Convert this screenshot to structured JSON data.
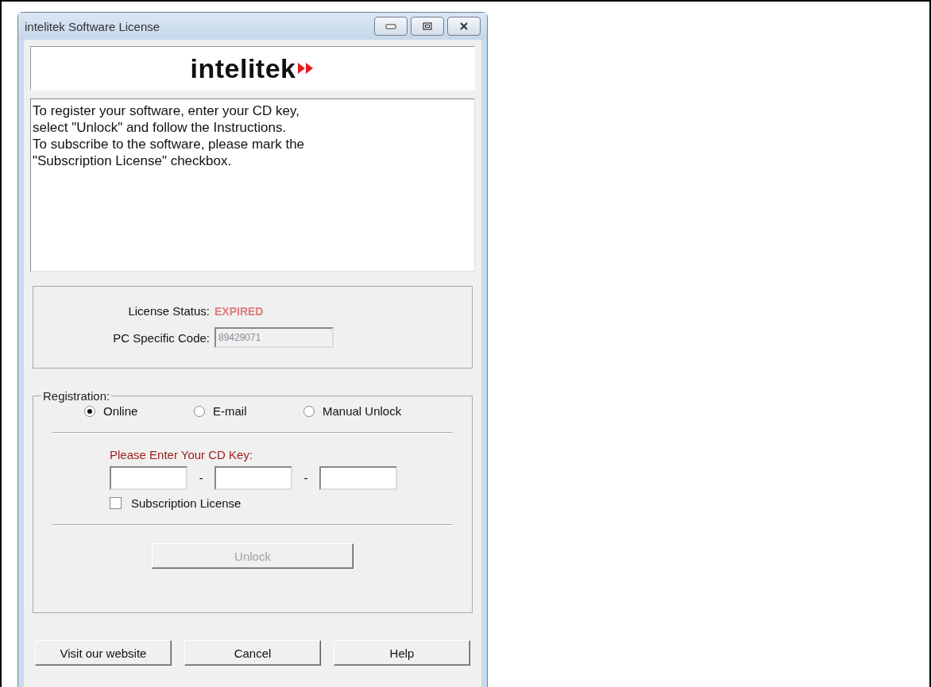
{
  "window": {
    "title": "intelitek Software License"
  },
  "logo": {
    "text": "intelitek"
  },
  "instructions": [
    "To register your software, enter your CD key,",
    "select \"Unlock\" and follow the Instructions.",
    "To subscribe to the software, please mark the",
    "\"Subscription License\" checkbox."
  ],
  "status": {
    "license_label": "License Status:",
    "license_value": "EXPIRED",
    "code_label": "PC Specific Code:",
    "code_value": "89429071"
  },
  "registration": {
    "legend": "Registration:",
    "methods": [
      {
        "label": "Online",
        "selected": true
      },
      {
        "label": "E-mail",
        "selected": false
      },
      {
        "label": "Manual Unlock",
        "selected": false
      }
    ],
    "cd_key_label": "Please Enter Your CD Key:",
    "separators": [
      "-",
      "-"
    ],
    "subscription": {
      "label": "Subscription License",
      "checked": false
    },
    "unlock": {
      "label": "Unlock",
      "disabled": true
    }
  },
  "buttons": [
    "Visit our website",
    "Cancel",
    "Help"
  ]
}
